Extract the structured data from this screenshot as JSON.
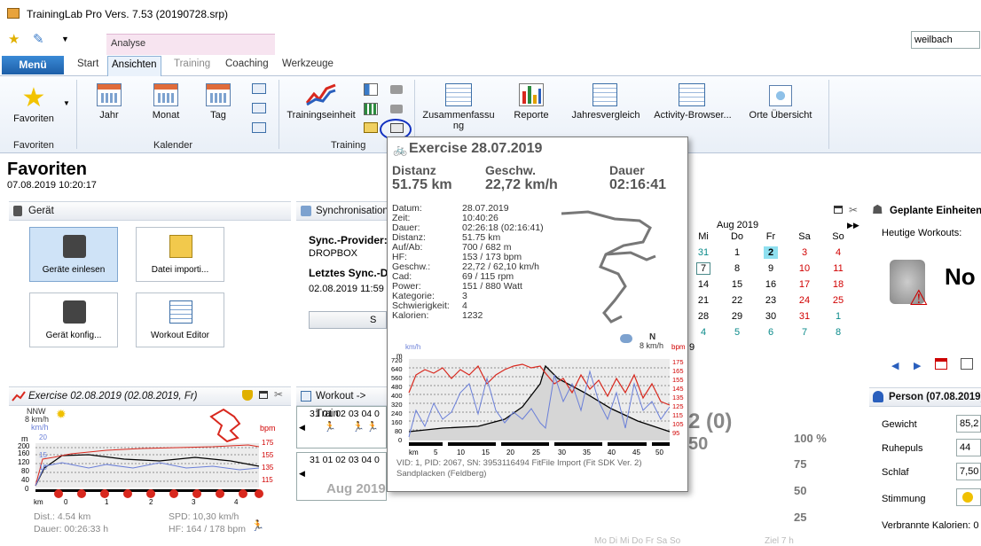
{
  "window": {
    "title": "TrainingLab Pro Vers. 7.53 (20190728.srp)"
  },
  "search": {
    "value": "weilbach"
  },
  "ribbon": {
    "context_tab": "Analyse",
    "menu_label": "Menü",
    "tabs": [
      {
        "label": "Start"
      },
      {
        "label": "Ansichten"
      },
      {
        "label": "Training"
      },
      {
        "label": "Coaching"
      },
      {
        "label": "Werkzeuge"
      }
    ],
    "favoriten_label": "Favoriten",
    "kal_jahr": "Jahr",
    "kal_monat": "Monat",
    "kal_tag": "Tag",
    "trainingseinheit": "Trainingseinheit",
    "zusammenfassung": "Zusammenfassu\nng",
    "reporte": "Reporte",
    "jahresvergleich": "Jahresvergleich",
    "activity_browser": "Activity-Browser...",
    "orte": "Orte Übersicht",
    "groups": {
      "favoriten": "Favoriten",
      "kalender": "Kalender",
      "training": "Training"
    }
  },
  "page": {
    "title": "Favoriten",
    "datetime": "07.08.2019 10:20:17"
  },
  "geraet": {
    "header": "Gerät",
    "tiles": [
      "Geräte einlesen",
      "Datei importi...",
      "Gerät konfig...",
      "Workout Editor"
    ]
  },
  "sync": {
    "header": "Synchronisationss",
    "provider_label": "Sync.-Provider:",
    "provider_value": "DROPBOX",
    "last_label": "Letztes Sync.-D",
    "last_value": "02.08.2019 11:59",
    "button": "S"
  },
  "calendar": {
    "month": "Aug 2019",
    "days": [
      "Mi",
      "Do",
      "Fr",
      "Sa",
      "So"
    ],
    "rows": [
      [
        "31",
        "1",
        "2",
        "3",
        "4"
      ],
      [
        "7",
        "8",
        "9",
        "10",
        "11"
      ],
      [
        "14",
        "15",
        "16",
        "17",
        "18"
      ],
      [
        "21",
        "22",
        "23",
        "24",
        "25"
      ],
      [
        "28",
        "29",
        "30",
        "31",
        "1"
      ],
      [
        "4",
        "5",
        "6",
        "7",
        "8"
      ]
    ],
    "extra": "9"
  },
  "geplant": {
    "header": "Geplante Einheiten",
    "sub": "Heutige Workouts:",
    "big": "No"
  },
  "exercise": {
    "header": "Exercise 02.08.2019 (02.08.2019, Fr)",
    "wind": "NNW",
    "wind_speed": "8 km/h",
    "kmh": "km/h",
    "m": "m",
    "bpm": "bpm",
    "y_left": [
      "200",
      "160",
      "120",
      "80",
      "40",
      "0"
    ],
    "y_mid": [
      "20",
      "15",
      "10"
    ],
    "y_right": [
      "175",
      "155",
      "135",
      "115"
    ],
    "km_label": "km",
    "x_ticks": [
      "0",
      "1",
      "2",
      "3",
      "4"
    ],
    "dist": "Dist.: 4.54 km",
    "dauer": "Dauer: 00:26:33 h",
    "spd": "SPD: 10,30 km/h",
    "hf": "HF: 164 / 178 bpm"
  },
  "workout": {
    "header": "Workout -> Train",
    "days1": [
      "31",
      "01",
      "02",
      "03",
      "04",
      "0"
    ],
    "days2": [
      "31",
      "01",
      "02",
      "03",
      "04",
      "0"
    ],
    "month": "Aug 2019"
  },
  "stats": {
    "big": "2 (0)",
    "big2": "50",
    "pct": [
      "100 %",
      "75",
      "50",
      "25"
    ]
  },
  "person": {
    "header": "Person (07.08.2019)",
    "rows": [
      {
        "label": "Gewicht",
        "value": "85,2"
      },
      {
        "label": "Ruhepuls",
        "value": "44"
      },
      {
        "label": "Schlaf",
        "value": "7,50"
      },
      {
        "label": "Stimmung",
        "value": ""
      }
    ],
    "kalorien": "Verbrannte Kalorien: 0"
  },
  "popup": {
    "title": "Exercise 28.07.2019",
    "distanz_label": "Distanz",
    "distanz": "51.75 km",
    "geschw_label": "Geschw.",
    "geschw": "22,72 km/h",
    "dauer_label": "Dauer",
    "dauer": "02:16:41",
    "details": [
      {
        "k": "Datum:",
        "v": "28.07.2019"
      },
      {
        "k": "Zeit:",
        "v": "10:40:26"
      },
      {
        "k": "Dauer:",
        "v": "02:26:18 (02:16:41)"
      },
      {
        "k": "Distanz:",
        "v": "51.75 km"
      },
      {
        "k": "Auf/Ab:",
        "v": "700 / 682 m"
      },
      {
        "k": "HF:",
        "v": "153 / 173 bpm"
      },
      {
        "k": "Geschw.:",
        "v": "22,72 / 62,10 km/h"
      },
      {
        "k": "Cad:",
        "v": "69 / 115 rpm"
      },
      {
        "k": "Power:",
        "v": "151 / 880 Watt"
      },
      {
        "k": "Kategorie:",
        "v": "3"
      },
      {
        "k": "Schwierigkeit:",
        "v": "4"
      },
      {
        "k": "Kalorien:",
        "v": "1232"
      }
    ],
    "wind": "N",
    "wind_speed": "8 km/h",
    "kmh": "km/h",
    "bpm": "bpm",
    "m": "m",
    "y_left": [
      "720",
      "640",
      "560",
      "480",
      "400",
      "320",
      "240",
      "160",
      "80",
      "0"
    ],
    "y_right": [
      "175",
      "165",
      "155",
      "145",
      "135",
      "125",
      "115",
      "105",
      "95"
    ],
    "x_ticks": [
      "km",
      "5",
      "10",
      "15",
      "20",
      "25",
      "30",
      "35",
      "40",
      "45",
      "50"
    ],
    "footer1": "VID: 1, PID: 2067, SN: 3953116494 FitFile Import (Fit SDK Ver. 2)",
    "footer2": "Sandplacken (Feldberg)"
  },
  "bottom": {
    "weekdays": "Mo Di Mi Do Fr Sa So",
    "ziel": "Ziel 7 h"
  }
}
